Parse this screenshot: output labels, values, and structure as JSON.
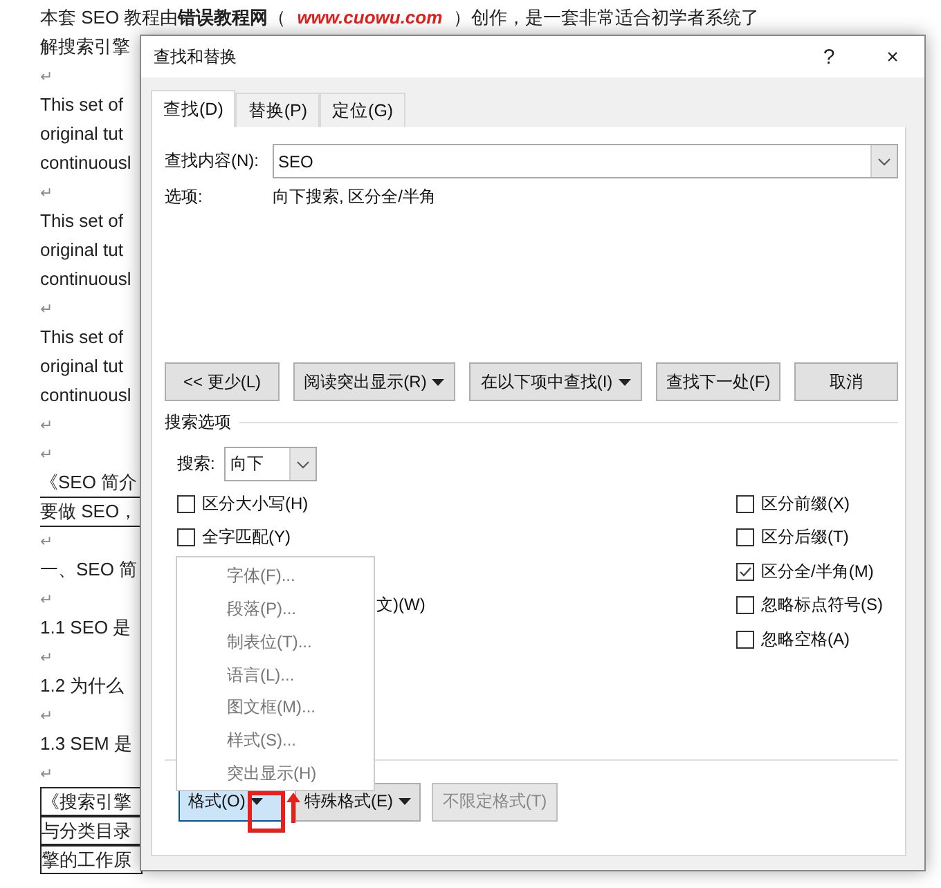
{
  "document": {
    "lines": [
      {
        "kind": "rich",
        "segments": [
          {
            "kind": "plain",
            "text": "本套 SEO 教程由"
          },
          {
            "kind": "bold",
            "text": "错误教程网"
          },
          {
            "kind": "plain",
            "text": "（ "
          },
          {
            "kind": "link",
            "text": "www.cuowu.com"
          },
          {
            "kind": "plain",
            "text": " ）创作，是一套非常适合初学者系统了"
          }
        ]
      },
      {
        "kind": "text",
        "text": "解搜索引擎"
      },
      {
        "kind": "mark",
        "text": "↵"
      },
      {
        "kind": "text",
        "text": "This set of"
      },
      {
        "kind": "text",
        "text": "original tut"
      },
      {
        "kind": "text",
        "text": "continuousl"
      },
      {
        "kind": "mark",
        "text": "↵"
      },
      {
        "kind": "text",
        "text": "This set of"
      },
      {
        "kind": "text",
        "text": "original tut"
      },
      {
        "kind": "text",
        "text": "continuousl"
      },
      {
        "kind": "mark",
        "text": "↵"
      },
      {
        "kind": "text",
        "text": "This set of"
      },
      {
        "kind": "text",
        "text": "original tut"
      },
      {
        "kind": "text",
        "text": "continuousl"
      },
      {
        "kind": "mark",
        "text": "↵"
      },
      {
        "kind": "mark",
        "text": "↵"
      },
      {
        "kind": "underlined",
        "text": "《SEO 简介"
      },
      {
        "kind": "underlined",
        "text": "要做 SEO，"
      },
      {
        "kind": "mark",
        "text": "↵"
      },
      {
        "kind": "text",
        "text": "一、SEO 简"
      },
      {
        "kind": "mark",
        "text": "↵"
      },
      {
        "kind": "text",
        "text": "1.1 SEO 是"
      },
      {
        "kind": "mark",
        "text": "↵"
      },
      {
        "kind": "text",
        "text": "1.2  为什么"
      },
      {
        "kind": "mark",
        "text": "↵"
      },
      {
        "kind": "text",
        "text": "1.3 SEM 是"
      },
      {
        "kind": "mark",
        "text": "↵"
      },
      {
        "kind": "boxed",
        "text": "《搜索引擎"
      },
      {
        "kind": "boxed",
        "text": "与分类目录"
      },
      {
        "kind": "boxed",
        "text": "擎的工作原"
      }
    ]
  },
  "dialog": {
    "title": "查找和替换",
    "help": "?",
    "close": "×",
    "tabs": [
      {
        "label": "查找(D)",
        "selected": true
      },
      {
        "label": "替换(P)",
        "selected": false
      },
      {
        "label": "定位(G)",
        "selected": false
      }
    ],
    "find_label": "查找内容(N):",
    "find_value": "SEO",
    "options_label": "选项:",
    "options_value": "向下搜索, 区分全/半角",
    "buttons": [
      {
        "label": "<< 更少(L)",
        "dropdown": false
      },
      {
        "label": "阅读突出显示(R)",
        "dropdown": true
      },
      {
        "label": "在以下项中查找(I)",
        "dropdown": true
      },
      {
        "label": "查找下一处(F)",
        "dropdown": false
      },
      {
        "label": "取消",
        "dropdown": false
      }
    ],
    "search_options_heading": "搜索选项",
    "search_label": "搜索:",
    "search_value": "向下",
    "left_options": [
      {
        "label": "区分大小写(H)",
        "checked": false
      },
      {
        "label": "全字匹配(Y)",
        "checked": false
      }
    ],
    "partial_label": "文)(W)",
    "right_options": [
      {
        "label": "区分前缀(X)",
        "checked": false
      },
      {
        "label": "区分后缀(T)",
        "checked": false
      },
      {
        "label": "区分全/半角(M)",
        "checked": true
      },
      {
        "label": "忽略标点符号(S)",
        "checked": false
      },
      {
        "label": "忽略空格(A)",
        "checked": false
      }
    ],
    "bottom_buttons": [
      {
        "label": "格式(O)",
        "dropdown": true,
        "pressed": true,
        "disabled": false
      },
      {
        "label": "特殊格式(E)",
        "dropdown": true,
        "pressed": false,
        "disabled": false
      },
      {
        "label": "不限定格式(T)",
        "dropdown": false,
        "pressed": false,
        "disabled": true
      }
    ],
    "menu": [
      "字体(F)...",
      "段落(P)...",
      "制表位(T)...",
      "语言(L)...",
      "图文框(M)...",
      "样式(S)...",
      "突出显示(H)"
    ]
  }
}
